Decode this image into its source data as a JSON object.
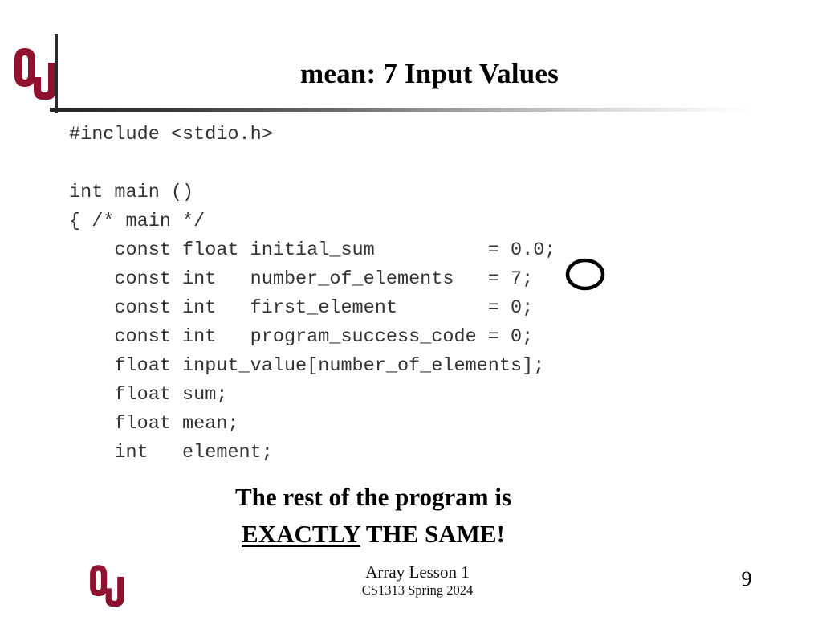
{
  "slide": {
    "title": "mean: 7 Input Values",
    "page_number": "9",
    "brand_color": "#8E1230",
    "code_color": "#333333"
  },
  "logos": {
    "top": "ou-logo-icon",
    "bottom": "ou-logo-icon"
  },
  "code": {
    "language": "c",
    "lines": [
      "#include <stdio.h>",
      "",
      "int main ()",
      "{ /* main */",
      "    const float initial_sum          = 0.0;",
      "    const int   number_of_elements   = 7;",
      "    const int   first_element        = 0;",
      "    const int   program_success_code = 0;",
      "    float input_value[number_of_elements];",
      "    float sum;",
      "    float mean;",
      "    int   element;"
    ]
  },
  "annotation": {
    "shape": "ellipse",
    "target_text": "7;",
    "color": "#000000"
  },
  "emphasis": {
    "line1": "The rest of the program is",
    "line2_underlined": "EXACTLY",
    "line2_rest": " THE SAME!"
  },
  "footer": {
    "lesson": "Array Lesson 1",
    "course": "CS1313 Spring 2024"
  }
}
